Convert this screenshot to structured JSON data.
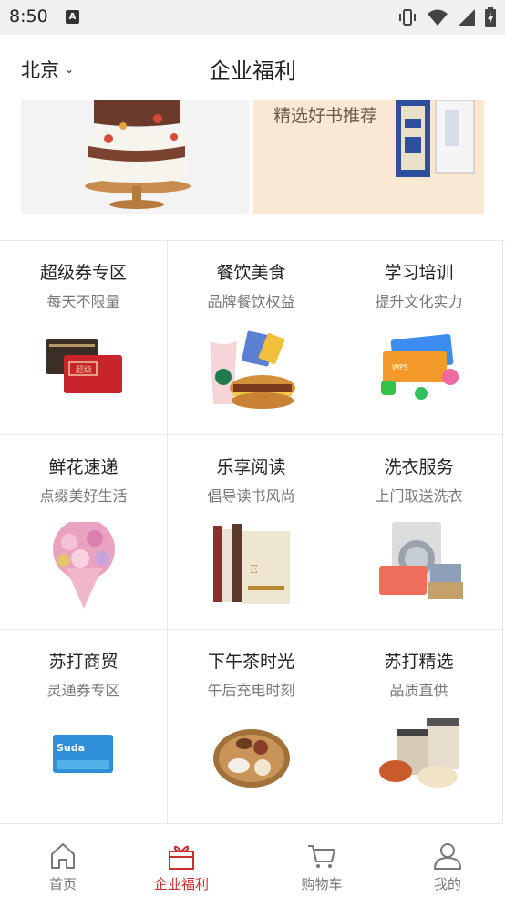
{
  "status": {
    "time": "8:50"
  },
  "header": {
    "city": "北京",
    "title": "企业福利"
  },
  "banner": {
    "right_text": "精选好书推荐"
  },
  "categories": [
    {
      "title": "超级券专区",
      "subtitle": "每天不限量",
      "icon": "cards-image"
    },
    {
      "title": "餐饮美食",
      "subtitle": "品牌餐饮权益",
      "icon": "food-coffee-image"
    },
    {
      "title": "学习培训",
      "subtitle": "提升文化实力",
      "icon": "learning-cards-image"
    },
    {
      "title": "鲜花速递",
      "subtitle": "点缀美好生活",
      "icon": "flower-bouquet-image"
    },
    {
      "title": "乐享阅读",
      "subtitle": "倡导读书风尚",
      "icon": "books-image"
    },
    {
      "title": "洗衣服务",
      "subtitle": "上门取送洗衣",
      "icon": "laundry-image"
    },
    {
      "title": "苏打商贸",
      "subtitle": "灵通券专区",
      "icon": "suda-card-image"
    },
    {
      "title": "下午茶时光",
      "subtitle": "午后充电时刻",
      "icon": "afternoon-tea-image"
    },
    {
      "title": "苏打精选",
      "subtitle": "品质直供",
      "icon": "snack-jars-image"
    }
  ],
  "tabs": [
    {
      "label": "首页",
      "icon": "home-icon",
      "active": false
    },
    {
      "label": "企业福利",
      "icon": "gift-icon",
      "active": true
    },
    {
      "label": "购物车",
      "icon": "cart-icon",
      "active": false
    },
    {
      "label": "我的",
      "icon": "user-icon",
      "active": false
    }
  ],
  "colors": {
    "accent": "#c8302e",
    "muted": "#777777",
    "divider": "#e7e7e7"
  }
}
